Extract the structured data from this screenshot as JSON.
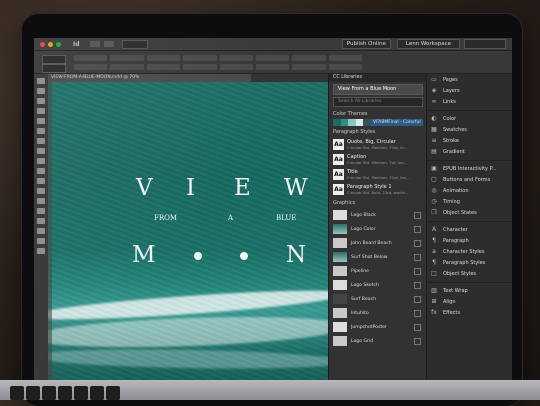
{
  "app": {
    "app_id": "Id",
    "zoom": "",
    "publish_label": "Publish Online",
    "workspace_label": "Lenn Workspace",
    "document_tab": "VIEW-FROM-A-BLUE-MOON.indd @ 70%"
  },
  "canvas": {
    "title_top": [
      "V",
      "I",
      "E",
      "W"
    ],
    "subtitle": [
      "FROM",
      "A",
      "BLUE"
    ],
    "title_bottom_left": "M",
    "title_bottom_right": "N"
  },
  "libraries": {
    "header": "CC Libraries",
    "selected_library": "View From a Blue Moon",
    "search_placeholder": "Search All Libraries",
    "color_themes_label": "Color Themes",
    "theme_name": "VFABMFinal - Colorful",
    "theme_colors": [
      "#1c6b66",
      "#2f8d86",
      "#8cc7c1",
      "#d9ecea",
      "#35525a"
    ],
    "paragraph_styles_label": "Paragraph Styles",
    "paragraph_styles": [
      {
        "name": "Quote, Big, Circular",
        "desc": "Circular Std, Medium, 72pt, le..."
      },
      {
        "name": "Caption",
        "desc": "Circular Std, Medium, 7pt, lea..."
      },
      {
        "name": "Title",
        "desc": "Circular Std, Medium, 72pt, lea..."
      },
      {
        "name": "Paragraph Style 1",
        "desc": "Circular Std, Bold, 23pt, leadin..."
      }
    ],
    "graphics_label": "Graphics",
    "graphics": [
      {
        "name": "Logo Black"
      },
      {
        "name": "Logo Color"
      },
      {
        "name": "John Board Beach"
      },
      {
        "name": "Surf Shot Below"
      },
      {
        "name": "Pipeline"
      },
      {
        "name": "Logo Sketch"
      },
      {
        "name": "Surf Beach"
      },
      {
        "name": "Intuhito"
      },
      {
        "name": "JumpshotPoster"
      },
      {
        "name": "Logo Grid"
      }
    ]
  },
  "dock": {
    "group1": [
      "Pages",
      "Layers",
      "Links"
    ],
    "group2": [
      "Color",
      "Swatches",
      "Stroke",
      "Gradient"
    ],
    "group3": [
      "EPUB Interactivity P...",
      "Buttons and Forms",
      "Animation",
      "Timing",
      "Object States"
    ],
    "group4": [
      "Character",
      "Paragraph",
      "Character Styles",
      "Paragraph Styles",
      "Object Styles"
    ],
    "group5": [
      "Text Wrap",
      "Align",
      "Effects"
    ]
  }
}
